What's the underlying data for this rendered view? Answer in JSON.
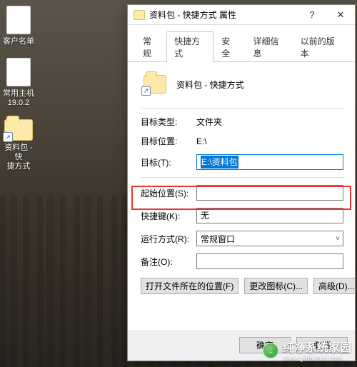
{
  "desktop": {
    "icons": [
      {
        "label": "客户名单"
      },
      {
        "label": "常用主机\n19.0.2"
      },
      {
        "label": "资料包 - 快\n捷方式"
      }
    ]
  },
  "dialog": {
    "title": "资料包 - 快捷方式 属性",
    "tabs": [
      "常规",
      "快捷方式",
      "安全",
      "详细信息",
      "以前的版本"
    ],
    "active_tab_index": 1,
    "header_name": "资料包 - 快捷方式",
    "rows": {
      "type_label": "目标类型:",
      "type_value": "文件夹",
      "location_label": "目标位置:",
      "location_value": "E:\\",
      "target_label": "目标(T):",
      "target_value": "E:\\资料包",
      "startin_label": "起始位置(S):",
      "startin_value": "",
      "hotkey_label": "快捷键(K):",
      "hotkey_value": "无",
      "run_label": "运行方式(R):",
      "run_value": "常规窗口",
      "comment_label": "备注(O):",
      "comment_value": ""
    },
    "buttons": {
      "open_loc": "打开文件所在的位置(F)",
      "change_icon": "更改图标(C)...",
      "advanced": "高级(D)...",
      "ok": "确定",
      "cancel": "取消"
    }
  },
  "watermark": {
    "brand": "纯净系统家园",
    "url": "www.yidaimei.com",
    "icon_glyph": "↓"
  }
}
